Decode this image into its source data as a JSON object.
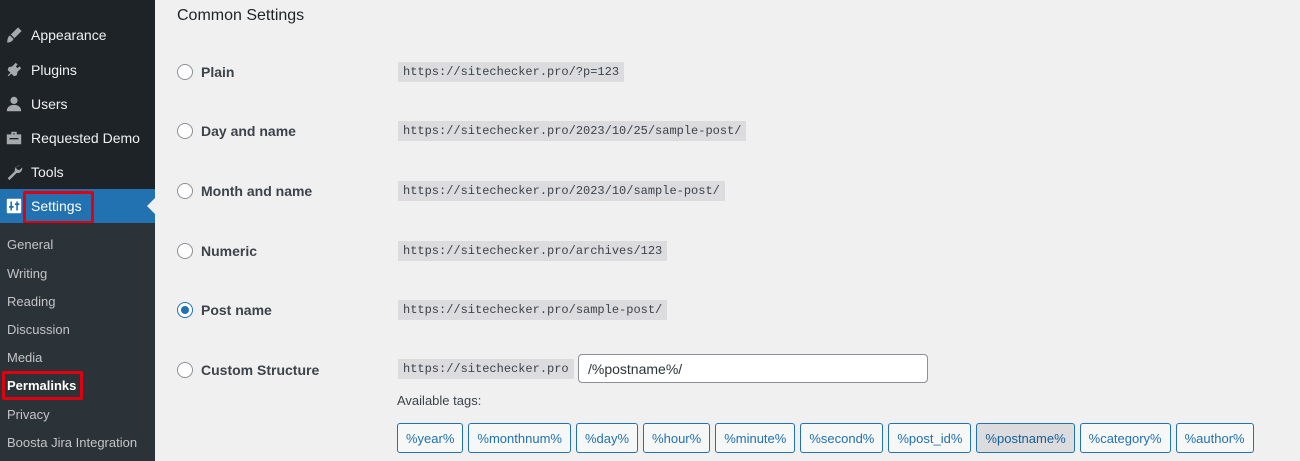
{
  "sidebar": {
    "menu": [
      {
        "label": "Appearance",
        "icon": "paintbrush-icon"
      },
      {
        "label": "Plugins",
        "icon": "plug-icon"
      },
      {
        "label": "Users",
        "icon": "user-icon"
      },
      {
        "label": "Requested Demo",
        "icon": "briefcase-icon"
      },
      {
        "label": "Tools",
        "icon": "wrench-icon"
      },
      {
        "label": "Settings",
        "icon": "settings-icon",
        "active": true
      }
    ],
    "submenu": [
      {
        "label": "General"
      },
      {
        "label": "Writing"
      },
      {
        "label": "Reading"
      },
      {
        "label": "Discussion"
      },
      {
        "label": "Media"
      },
      {
        "label": "Permalinks",
        "current": true
      },
      {
        "label": "Privacy"
      },
      {
        "label": "Boosta Jira Integration"
      }
    ]
  },
  "main": {
    "title": "Common Settings",
    "options": [
      {
        "label": "Plain",
        "example": "https://sitechecker.pro/?p=123",
        "checked": false
      },
      {
        "label": "Day and name",
        "example": "https://sitechecker.pro/2023/10/25/sample-post/",
        "checked": false
      },
      {
        "label": "Month and name",
        "example": "https://sitechecker.pro/2023/10/sample-post/",
        "checked": false
      },
      {
        "label": "Numeric",
        "example": "https://sitechecker.pro/archives/123",
        "checked": false
      },
      {
        "label": "Post name",
        "example": "https://sitechecker.pro/sample-post/",
        "checked": true
      },
      {
        "label": "Custom Structure",
        "example": "https://sitechecker.pro",
        "checked": false
      }
    ],
    "custom_value": "/%postname%/",
    "available_tags_label": "Available tags:",
    "tags": [
      "%year%",
      "%monthnum%",
      "%day%",
      "%hour%",
      "%minute%",
      "%second%",
      "%post_id%",
      "%postname%",
      "%category%",
      "%author%"
    ],
    "active_tag": "%postname%"
  },
  "colors": {
    "sidebar_bg": "#1d2327",
    "submenu_bg": "#2c3338",
    "accent": "#2271b1",
    "highlight": "#e0000f"
  }
}
